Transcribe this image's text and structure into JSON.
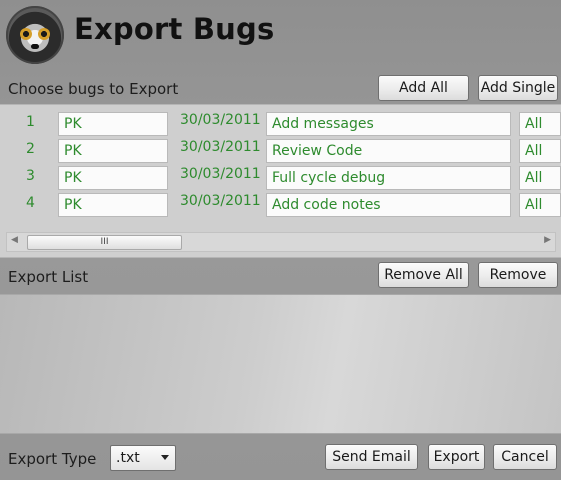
{
  "header": {
    "title": "Export Bugs"
  },
  "choose": {
    "label": "Choose bugs to Export",
    "add_all": "Add All",
    "add_single": "Add Single"
  },
  "bugs": [
    {
      "id": "1",
      "owner": "PK",
      "date": "30/03/2011",
      "desc": "Add messages",
      "extra": "All"
    },
    {
      "id": "2",
      "owner": "PK",
      "date": "30/03/2011",
      "desc": "Review Code",
      "extra": "All"
    },
    {
      "id": "3",
      "owner": "PK",
      "date": "30/03/2011",
      "desc": "Full cycle debug",
      "extra": "All"
    },
    {
      "id": "4",
      "owner": "PK",
      "date": "30/03/2011",
      "desc": "Add code notes",
      "extra": "All"
    }
  ],
  "scroll": {
    "grip": "III"
  },
  "export_list": {
    "label": "Export List",
    "remove_all": "Remove All",
    "remove": "Remove"
  },
  "footer": {
    "export_type_label": "Export Type",
    "export_type_value": ".txt",
    "send_email": "Send Email",
    "export": "Export",
    "cancel": "Cancel"
  },
  "colors": {
    "accent_text": "#2e8b2e"
  }
}
